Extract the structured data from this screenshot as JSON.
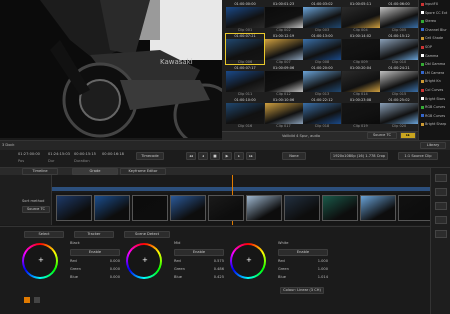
{
  "viewer": {
    "caption": "Kawasaki"
  },
  "library": {
    "thumbs": [
      {
        "tc": "01:00:00:00",
        "name": "Clip 001"
      },
      {
        "tc": "01:00:01:23",
        "name": "Clip 002"
      },
      {
        "tc": "01:00:03:02",
        "name": "Clip 003"
      },
      {
        "tc": "01:00:05:11",
        "name": "Clip 004"
      },
      {
        "tc": "01:00:06:00",
        "name": "Clip 005"
      },
      {
        "tc": "01:00:07:21",
        "name": "Clip 006"
      },
      {
        "tc": "01:00:12:19",
        "name": "Clip 007"
      },
      {
        "tc": "01:00:13:00",
        "name": "Clip 008"
      },
      {
        "tc": "01:00:14:02",
        "name": "Clip 009"
      },
      {
        "tc": "01:00:15:12",
        "name": "Clip 010"
      },
      {
        "tc": "01:00:07:17",
        "name": "Clip 011"
      },
      {
        "tc": "01:00:09:06",
        "name": "Clip 012"
      },
      {
        "tc": "01:00:20:00",
        "name": "Clip 013"
      },
      {
        "tc": "01:00:20:04",
        "name": "Clip 014"
      },
      {
        "tc": "01:00:24:21",
        "name": "Clip 015"
      },
      {
        "tc": "01:00:10:00",
        "name": "Clip 016"
      },
      {
        "tc": "01:00:10:06",
        "name": "Clip 017"
      },
      {
        "tc": "01:00:22:12",
        "name": "Clip 018"
      },
      {
        "tc": "01:00:23:08",
        "name": "Clip 019"
      },
      {
        "tc": "01:00:25:02",
        "name": "Clip 020"
      }
    ],
    "bottom_label": "Vollbild 4 Spur, audio",
    "source_tc": "Source TC",
    "library_btn": "Library"
  },
  "right_panel": {
    "items": [
      "InputFX",
      "Spore CC Ext",
      "Stereo",
      "Channel Blur",
      "Cell Shade",
      "SOP",
      "Gamma",
      "Dbl Gamma",
      "LM Camera",
      "Bright Kn",
      "Col Curves",
      "Bright Stars",
      "RGB Curves",
      "RGB Curves",
      "Bright Sharp"
    ]
  },
  "toolbar": {
    "header": "3 Dock",
    "timecodes": [
      "01:27:00:00",
      "01:24:15:03",
      "00:00:15:15",
      "00:00:16:18"
    ],
    "tc_labels": [
      "Pos",
      "Dur",
      "Duration"
    ],
    "timecode_btn": "Timecode",
    "mode": "None",
    "format": "1920x1080p (16) 1.778 Crop",
    "source": "1:1 Source Clip"
  },
  "tabs": [
    "Timeline",
    "Grade",
    "Keyframe Editor"
  ],
  "track_panel": {
    "label": "Sort method",
    "value": "Source TC"
  },
  "grade_tabs": [
    "Select",
    "Tracker",
    "Scene Detect"
  ],
  "wheels": [
    {
      "title": "Black",
      "enable": "Enable",
      "rows": [
        {
          "k": "Red",
          "v": "0.000"
        },
        {
          "k": "Green",
          "v": "0.000"
        },
        {
          "k": "Blue",
          "v": "0.000"
        }
      ]
    },
    {
      "title": "Mid",
      "enable": "Enable",
      "rows": [
        {
          "k": "Red",
          "v": "0.575"
        },
        {
          "k": "Green",
          "v": "0.486"
        },
        {
          "k": "Blue",
          "v": "0.425"
        }
      ]
    },
    {
      "title": "White",
      "enable": "Enable",
      "rows": [
        {
          "k": "Red",
          "v": "1.000"
        },
        {
          "k": "Green",
          "v": "1.000"
        },
        {
          "k": "Blue",
          "v": "1.014"
        }
      ]
    }
  ],
  "colour_btn": "Colour: Linear (3 CH)"
}
